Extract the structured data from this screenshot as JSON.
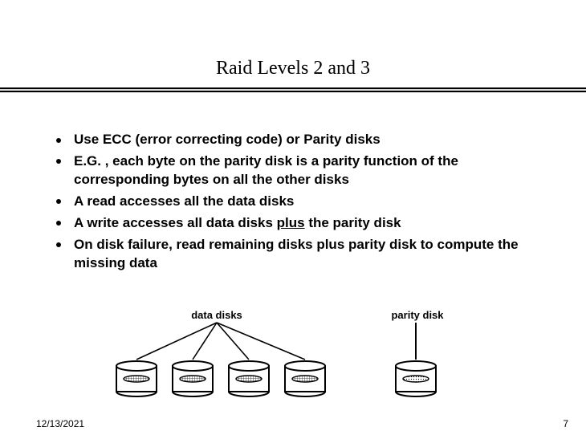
{
  "title": "Raid Levels 2 and 3",
  "bullets": [
    {
      "text": "Use ECC (error correcting code) or Parity disks"
    },
    {
      "text_pre": "E.G. , each byte on the parity disk is a parity function of the corresponding bytes on all the other disks"
    },
    {
      "text": "A read accesses all the data disks"
    },
    {
      "text_pre": "A write accesses all data disks ",
      "text_u": "plus",
      "text_post": " the parity disk"
    },
    {
      "text": "On disk failure, read remaining disks plus parity disk to compute the missing data"
    }
  ],
  "labels": {
    "data_disks": "data disks",
    "parity_disk": "parity disk"
  },
  "footer": {
    "date": "12/13/2021",
    "page": "7"
  }
}
